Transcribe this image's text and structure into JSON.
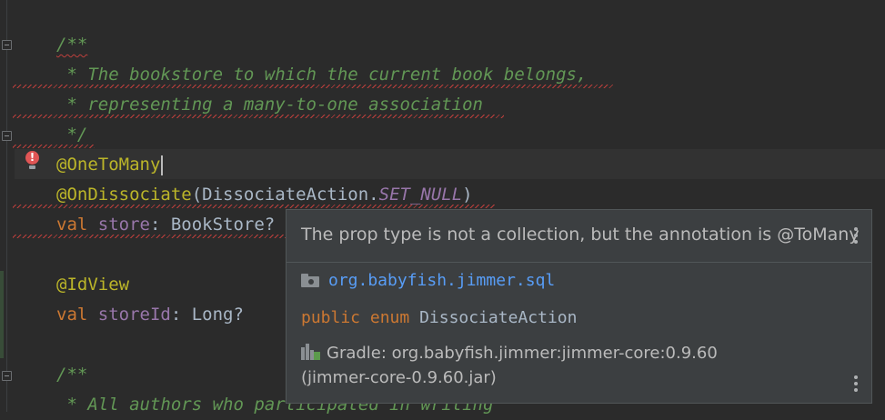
{
  "editor": {
    "lines": [
      {
        "parts": [
          {
            "t": "/**",
            "c": "comment typo"
          }
        ]
      },
      {
        "parts": [
          {
            "t": " * The bookstore to which the current book belongs,",
            "c": "comment"
          }
        ]
      },
      {
        "parts": [
          {
            "t": " * representing a many-to-one association",
            "c": "comment"
          }
        ]
      },
      {
        "parts": [
          {
            "t": " */",
            "c": "comment"
          }
        ]
      },
      {
        "parts": [
          {
            "t": "@OneToMany",
            "c": "ann"
          }
        ]
      },
      {
        "parts": [
          {
            "t": "@OnDissociate",
            "c": "ann"
          },
          {
            "t": "(DissociateAction.",
            "c": ""
          },
          {
            "t": "SET_NULL",
            "c": "cst"
          },
          {
            "t": ")",
            "c": ""
          }
        ]
      },
      {
        "parts": [
          {
            "t": "val ",
            "c": "kw"
          },
          {
            "t": "store",
            "c": "fld"
          },
          {
            "t": ": BookStore?",
            "c": ""
          }
        ]
      },
      {
        "parts": []
      },
      {
        "parts": [
          {
            "t": "@IdView",
            "c": "ann"
          }
        ]
      },
      {
        "parts": [
          {
            "t": "val ",
            "c": "kw"
          },
          {
            "t": "storeId",
            "c": "fld"
          },
          {
            "t": ": Long?",
            "c": ""
          }
        ]
      },
      {
        "parts": []
      },
      {
        "parts": [
          {
            "t": "/**",
            "c": "comment"
          }
        ]
      },
      {
        "parts": [
          {
            "t": " * All authors who participated in writing",
            "c": "comment"
          }
        ]
      }
    ]
  },
  "icons": {
    "error_bulb": "error-bulb-icon",
    "package": "package-folder-icon",
    "library": "gradle-library-icon",
    "more": "more-vertical-icon"
  },
  "popup": {
    "message": "The prop type is not a collection, but the annotation is @ToMany",
    "package": "org.babyfish.jimmer.sql",
    "decl": {
      "kw1": "public",
      "kw2": "enum",
      "name": "DissociateAction"
    },
    "gradle": "Gradle: org.babyfish.jimmer:jimmer-core:0.9.60",
    "jar": "(jimmer-core-0.9.60.jar)"
  },
  "colors": {
    "background": "#2b2b2b",
    "comment": "#629755",
    "annotation": "#bbb529",
    "keyword": "#cc7832",
    "field": "#9876aa",
    "error": "#bc3f3c",
    "link": "#589df6",
    "popup_bg": "#3c3f41"
  }
}
